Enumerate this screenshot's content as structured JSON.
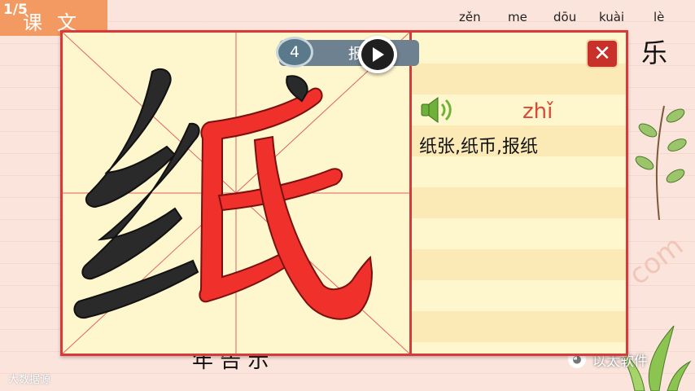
{
  "header": {
    "page_indicator": "1/5",
    "lesson_title": "课文"
  },
  "pinyin_row": [
    {
      "text": "zěn"
    },
    {
      "text": "me"
    },
    {
      "text": "dōu"
    },
    {
      "text": "kuài"
    },
    {
      "text": "lè"
    }
  ],
  "background_char": "乐",
  "bottom_text": "年 告 示",
  "watermark": {
    "left_logo": "大数据源",
    "right_logo": "以太软件",
    "com_text": "com"
  },
  "stroke_control": {
    "stroke_number": "4",
    "label": "报",
    "play_icon": "play-icon"
  },
  "character_card": {
    "character": "纸",
    "pinyin": "zhǐ",
    "words": "纸张,纸币,报纸",
    "speaker_icon": "speaker-icon",
    "close_icon": "close-icon"
  },
  "colors": {
    "stroke_highlight": "#f0302a",
    "stroke_dark": "#2a2a2a",
    "grid_line": "#e06060",
    "panel_bg": "#fef6cc",
    "border": "#d83a3a",
    "accent_orange": "#f39a63"
  }
}
